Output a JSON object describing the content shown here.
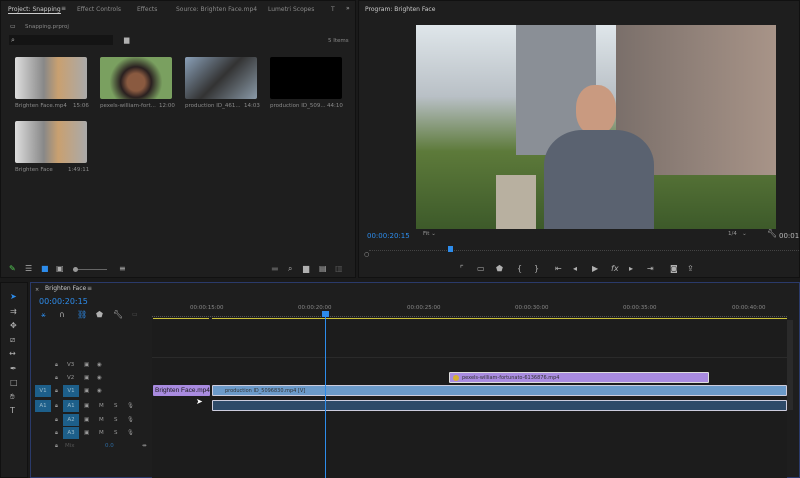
{
  "project_panel": {
    "tabs": [
      "Project: Snapping",
      "Effect Controls",
      "Effects",
      "Source: Brighten Face.mp4",
      "Lumetri Scopes",
      "T"
    ],
    "file": "Snapping.prproj",
    "search_placeholder": "",
    "items_count": "5 Items",
    "items": [
      {
        "name": "Brighten Face.mp4",
        "duration": "15:06"
      },
      {
        "name": "pexels-william-fort...",
        "duration": "12:00"
      },
      {
        "name": "production ID_461...",
        "duration": "14:03"
      },
      {
        "name": "production ID_509...",
        "duration": "44:10"
      },
      {
        "name": "Brighten Face",
        "duration": "1:49:11"
      }
    ]
  },
  "program": {
    "title": "Program: Brighten Face",
    "timecode": "00:00:20:15",
    "fit": "Fit",
    "resolution": "1/4",
    "duration_partial": "00:01"
  },
  "timeline": {
    "title": "Brighten Face",
    "timecode": "00:00:20:15",
    "ruler": [
      "00:00:15:00",
      "00:00:20:00",
      "00:00:25:00",
      "00:00:30:00",
      "00:00:35:00",
      "00:00:40:00"
    ],
    "video_tracks": [
      {
        "name": "V3"
      },
      {
        "name": "V2"
      },
      {
        "name": "V1",
        "source": "V1"
      }
    ],
    "audio_tracks": [
      {
        "name": "A1",
        "source": "A1"
      },
      {
        "name": "A2"
      },
      {
        "name": "A3"
      }
    ],
    "mix": {
      "label": "Mix",
      "value": "0.0"
    },
    "clips": {
      "v1_a": "Brighten Face.mp4",
      "v1_b": "production ID_5096830.mp4 [V]",
      "v2": "pexels-william-fortunato-6136876.mp4",
      "fx": "fx"
    },
    "track_labels": {
      "m": "M",
      "s": "S"
    }
  },
  "colors": {
    "accent": "#2d8ceb",
    "clip_video": "#6b9ac9",
    "clip_purple": "#a98be0"
  }
}
